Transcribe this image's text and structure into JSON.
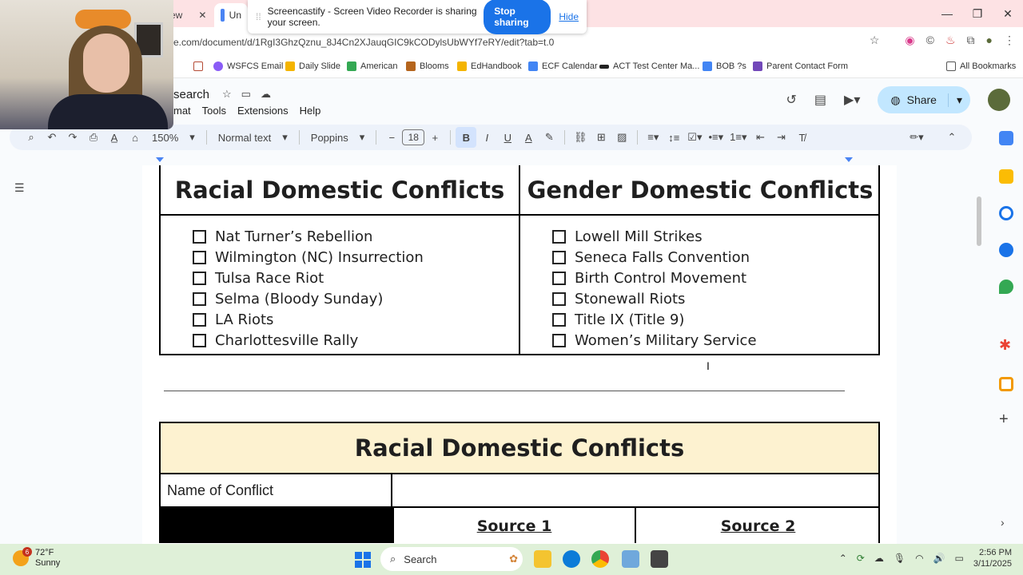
{
  "browser": {
    "tabs": [
      {
        "label": "ew"
      },
      {
        "label": "Un"
      }
    ],
    "url": "e.com/document/d/1RgI3GhzQznu_8J4Cn2XJauqGIC9kCODylsUbWYf7eRY/edit?tab=t.0",
    "sharing_bar": {
      "message": "Screencastify - Screen Video Recorder is sharing your screen.",
      "stop_label": "Stop sharing",
      "hide_label": "Hide"
    },
    "bookmarks": [
      {
        "label": "WSFCS Email",
        "color": "#8a5cf6"
      },
      {
        "label": "Daily Slide",
        "color": "#f4b400"
      },
      {
        "label": "American",
        "color": "#34a853"
      },
      {
        "label": "Blooms",
        "color": "#b5651d"
      },
      {
        "label": "EdHandbook",
        "color": "#f4b400"
      },
      {
        "label": "ECF Calendar",
        "color": "#4285f4"
      },
      {
        "label": "ACT Test Center Ma...",
        "color": "#222222"
      },
      {
        "label": "BOB ?s",
        "color": "#4285f4"
      },
      {
        "label": "Parent Contact Form",
        "color": "#7248b9"
      }
    ],
    "all_bookmarks": "All Bookmarks"
  },
  "docs": {
    "title": "search",
    "menus": [
      "mat",
      "Tools",
      "Extensions",
      "Help"
    ],
    "share_label": "Share",
    "toolbar": {
      "zoom": "150%",
      "style": "Normal text",
      "font": "Poppins",
      "font_size": "18",
      "bold": "B",
      "italic": "I",
      "underline": "U",
      "text_color": "A"
    }
  },
  "document": {
    "table1": {
      "left_heading": "Racial Domestic Conflicts",
      "right_heading": "Gender Domestic Conflicts",
      "left_items": [
        "Nat Turner’s Rebellion",
        "Wilmington (NC) Insurrection",
        "Tulsa Race Riot",
        "Selma (Bloody Sunday)",
        "LA Riots",
        "Charlottesville Rally"
      ],
      "right_items": [
        "Lowell Mill Strikes",
        "Seneca Falls Convention",
        "Birth Control Movement",
        "Stonewall Riots",
        "Title IX (Title 9)",
        "Women’s Military Service"
      ]
    },
    "table2": {
      "heading": "Racial Domestic Conflicts",
      "row_label": "Name of Conflict",
      "source1": "Source 1",
      "source2": "Source 2"
    }
  },
  "taskbar": {
    "weather_temp": "72°F",
    "weather_desc": "Sunny",
    "weather_badge": "6",
    "search_label": "Search",
    "time": "2:56 PM",
    "date": "3/11/2025"
  },
  "colors": {
    "accent": "#1a73e8",
    "table_header_fill": "#fdf2d0",
    "tabstrip": "#fde2e4",
    "taskbar": "#dff0d8"
  }
}
